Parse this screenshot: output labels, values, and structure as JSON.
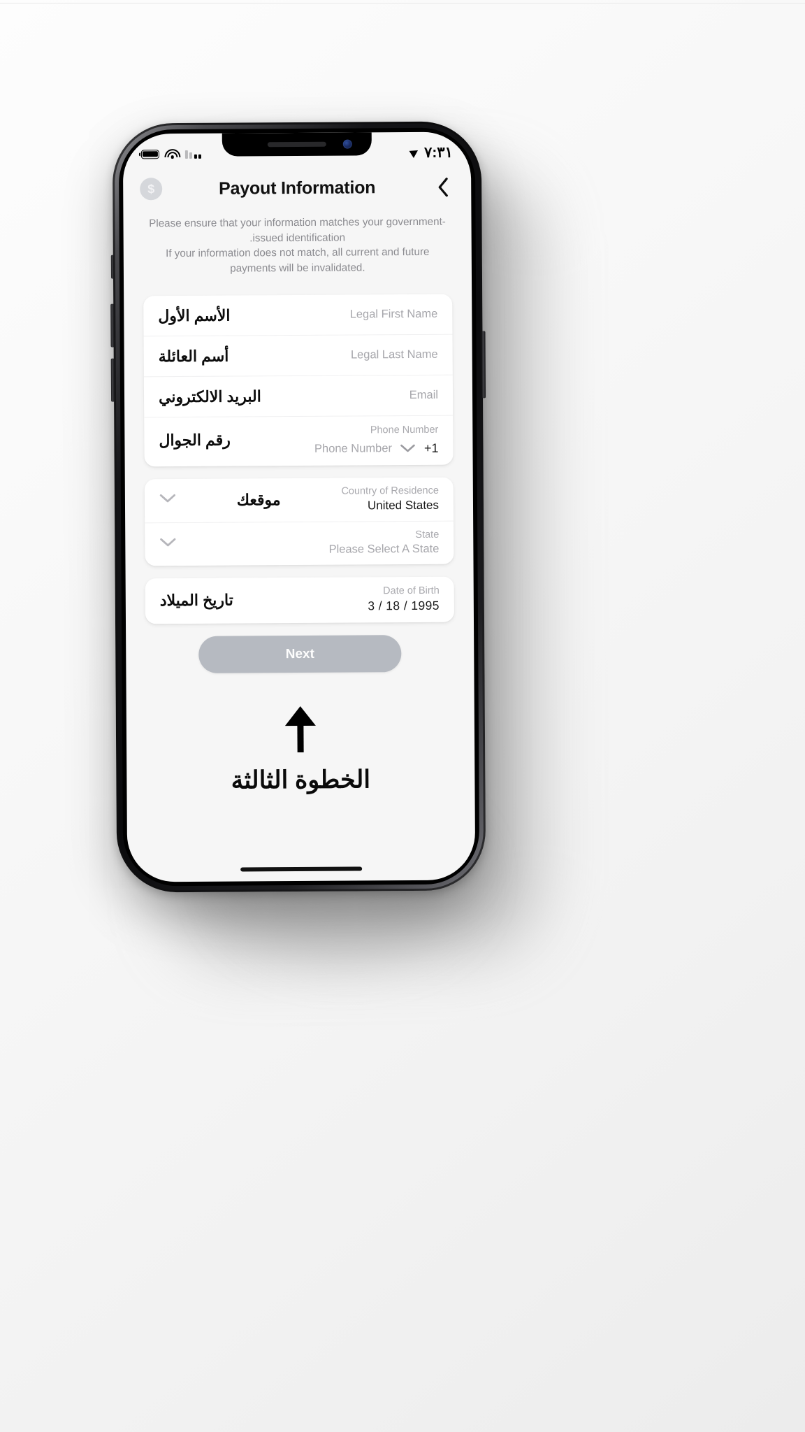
{
  "status_bar": {
    "battery_icon": "battery-icon",
    "wifi_icon": "wifi-icon",
    "signal_icon": "cellular-signal-icon",
    "location_icon": "location-arrow-icon",
    "time": "٧:٣١"
  },
  "header": {
    "avatar_glyph": "$",
    "title": "Payout Information",
    "back_icon": "chevron-left-icon"
  },
  "description": {
    "line1": "Please ensure that your information matches your government-",
    "line2": ".issued identification",
    "line3": "If your information does not match, all current and future",
    "line4": "payments will be invalidated."
  },
  "form": {
    "personal": [
      {
        "label_ar": "الأسم الأول",
        "placeholder_en": "Legal First Name"
      },
      {
        "label_ar": "أسم العائلة",
        "placeholder_en": "Legal Last Name"
      },
      {
        "label_ar": "البريد الالكتروني",
        "placeholder_en": "Email"
      }
    ],
    "phone": {
      "label_ar": "رقم الجوال",
      "field_label": "Phone Number",
      "placeholder_en": "Phone Number",
      "country_code": "+1",
      "chevron_icon": "chevron-down-icon"
    },
    "country": {
      "label_ar": "موقعك",
      "field_label": "Country of Residence",
      "value": "United States",
      "chevron_icon": "chevron-down-icon"
    },
    "state": {
      "field_label": "State",
      "value": "Please Select A State",
      "chevron_icon": "chevron-down-icon"
    },
    "dob": {
      "label_ar": "تاريخ الميلاد",
      "field_label": "Date of Birth",
      "value": "3 / 18 / 1995"
    }
  },
  "next_button": {
    "label": "Next",
    "color": "#b6bac1"
  },
  "annotation": {
    "arrow_icon": "arrow-up-icon",
    "caption_ar": "الخطوة الثالثة"
  }
}
